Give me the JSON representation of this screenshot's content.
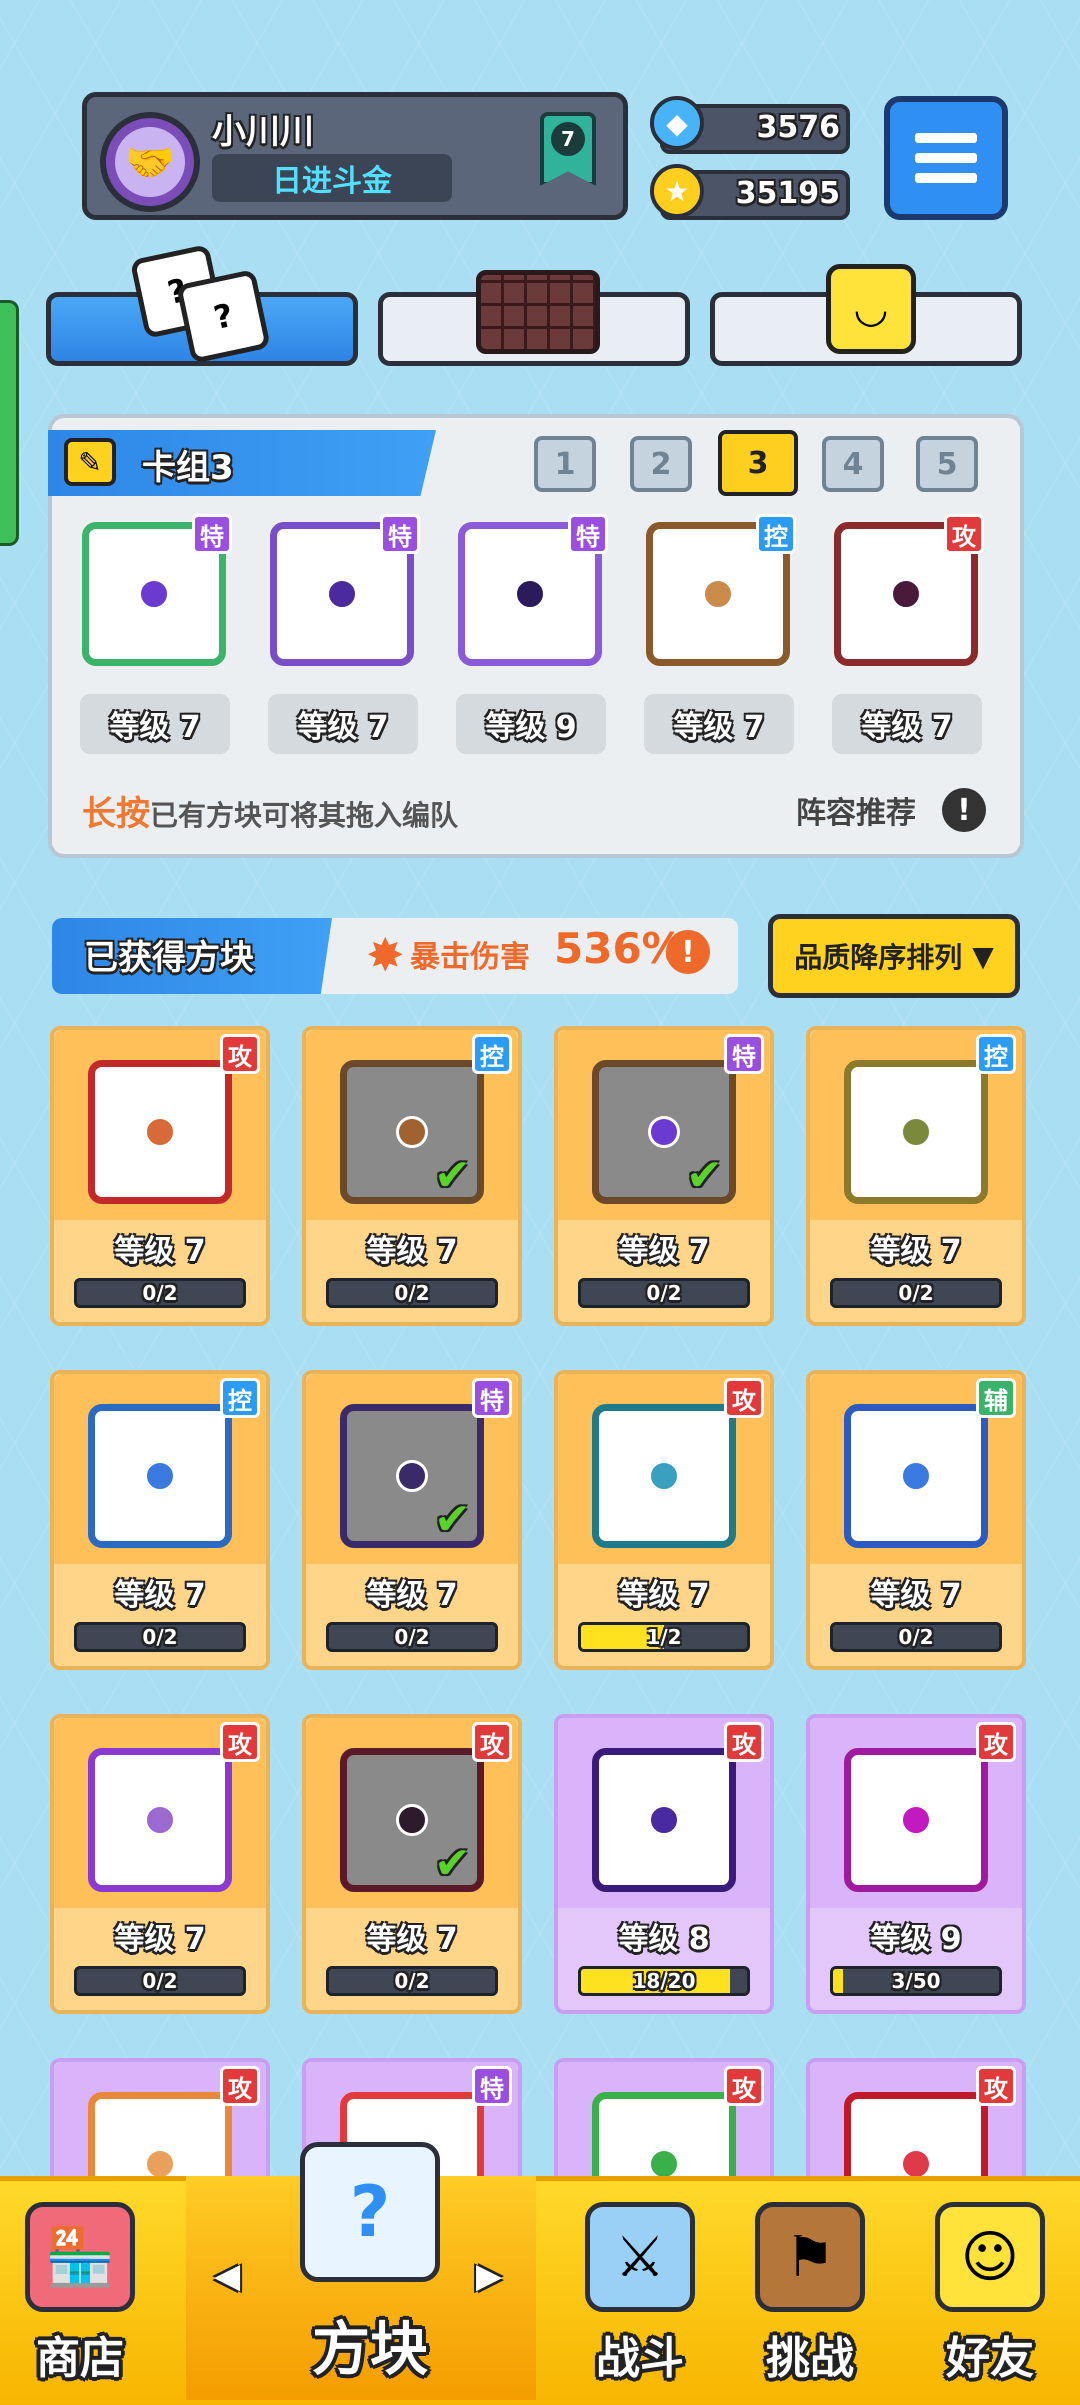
{
  "profile": {
    "name": "小川川",
    "title": "日进斗金",
    "rank": "7"
  },
  "currency": {
    "gems": "3576",
    "coins": "35195"
  },
  "tabs": [
    {
      "name": "dice-tab"
    },
    {
      "name": "board-tab"
    },
    {
      "name": "emote-tab"
    }
  ],
  "deck": {
    "label": "卡组3",
    "numbers": [
      "1",
      "2",
      "3",
      "4",
      "5"
    ],
    "selected": "3",
    "cards": [
      {
        "tag": "特",
        "tag_type": "te",
        "level": "等级 7",
        "ring": "#3bb36a",
        "dot": "#6b3ad1"
      },
      {
        "tag": "特",
        "tag_type": "te",
        "level": "等级 7",
        "ring": "#7a4dc9",
        "dot": "#4a2a9c"
      },
      {
        "tag": "特",
        "tag_type": "te",
        "level": "等级 9",
        "ring": "#8b5ad8",
        "dot": "#2b1a5c"
      },
      {
        "tag": "控",
        "tag_type": "kong",
        "level": "等级 7",
        "ring": "#8b5a2b",
        "dot": "#c98a4a"
      },
      {
        "tag": "攻",
        "tag_type": "gong",
        "level": "等级 7",
        "ring": "#8a2a2a",
        "dot": "#4a1a3a"
      }
    ],
    "hint_highlight": "长按",
    "hint_text": "已有方块可将其拖入编队",
    "lineup_label": "阵容推荐"
  },
  "owned": {
    "title": "已获得方块",
    "crit_label": "暴击伤害",
    "crit_value": "536%",
    "sort_label": "品质降序排列",
    "cards": [
      {
        "tag": "攻",
        "tag_type": "gong",
        "level": "等级 7",
        "progress": "0/2",
        "fill": 0,
        "ring": "#c22a2a",
        "dot": "#d86a3a",
        "check": false,
        "purple": false
      },
      {
        "tag": "控",
        "tag_type": "kong",
        "level": "等级 7",
        "progress": "0/2",
        "fill": 0,
        "ring": "#6a4a2a",
        "dot": "#a0632f",
        "check": true,
        "purple": false
      },
      {
        "tag": "特",
        "tag_type": "te",
        "level": "等级 7",
        "progress": "0/2",
        "fill": 0,
        "ring": "#6a4a2a",
        "dot": "#6b3ad1",
        "check": true,
        "purple": false
      },
      {
        "tag": "控",
        "tag_type": "kong",
        "level": "等级 7",
        "progress": "0/2",
        "fill": 0,
        "ring": "#8a7a2a",
        "dot": "#7a8a3a",
        "check": false,
        "purple": false
      },
      {
        "tag": "控",
        "tag_type": "kong",
        "level": "等级 7",
        "progress": "0/2",
        "fill": 0,
        "ring": "#2a6ac2",
        "dot": "#3a7ae0",
        "check": false,
        "purple": false
      },
      {
        "tag": "特",
        "tag_type": "te",
        "level": "等级 7",
        "progress": "0/2",
        "fill": 0,
        "ring": "#3a2a6a",
        "dot": "#3a2a6a",
        "check": true,
        "purple": false
      },
      {
        "tag": "攻",
        "tag_type": "gong",
        "level": "等级 7",
        "progress": "1/2",
        "fill": 0.5,
        "ring": "#1f7a8a",
        "dot": "#3aa0c0",
        "check": false,
        "purple": false
      },
      {
        "tag": "辅",
        "tag_type": "fu",
        "level": "等级 7",
        "progress": "0/2",
        "fill": 0,
        "ring": "#2a5ac2",
        "dot": "#3a7ae0",
        "check": false,
        "purple": false
      },
      {
        "tag": "攻",
        "tag_type": "gong",
        "level": "等级 7",
        "progress": "0/2",
        "fill": 0,
        "ring": "#8a3ad1",
        "dot": "#9b6ad1",
        "check": false,
        "purple": false
      },
      {
        "tag": "攻",
        "tag_type": "gong",
        "level": "等级 7",
        "progress": "0/2",
        "fill": 0,
        "ring": "#5a1a2a",
        "dot": "#2a1a2a",
        "check": true,
        "purple": false
      },
      {
        "tag": "攻",
        "tag_type": "gong",
        "level": "等级 8",
        "progress": "18/20",
        "fill": 0.9,
        "ring": "#3a1a7a",
        "dot": "#4a2aa0",
        "check": false,
        "purple": true
      },
      {
        "tag": "攻",
        "tag_type": "gong",
        "level": "等级 9",
        "progress": "3/50",
        "fill": 0.06,
        "ring": "#a01aa0",
        "dot": "#c01ac0",
        "check": false,
        "purple": true
      },
      {
        "tag": "攻",
        "tag_type": "gong",
        "level": "",
        "progress": "",
        "fill": 0,
        "ring": "#e8883a",
        "dot": "#e8a05a",
        "check": false,
        "purple": true
      },
      {
        "tag": "特",
        "tag_type": "te",
        "level": "",
        "progress": "",
        "fill": 0,
        "ring": "#e03a3a",
        "dot": "#e03a3a",
        "check": false,
        "purple": true
      },
      {
        "tag": "攻",
        "tag_type": "gong",
        "level": "",
        "progress": "",
        "fill": 0,
        "ring": "#3ab04a",
        "dot": "#3ab04a",
        "check": false,
        "purple": true
      },
      {
        "tag": "攻",
        "tag_type": "gong",
        "level": "",
        "progress": "",
        "fill": 0,
        "ring": "#c01a2a",
        "dot": "#e03a4a",
        "check": false,
        "purple": true
      }
    ]
  },
  "nav": {
    "shop": "商店",
    "blocks": "方块",
    "battle": "战斗",
    "challenge": "挑战",
    "friends": "好友"
  }
}
